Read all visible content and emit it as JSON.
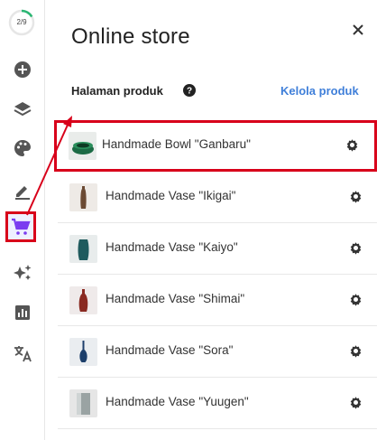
{
  "sidebar": {
    "progress": {
      "label": "2/9",
      "value": 0.222,
      "color": "#2bb673"
    },
    "items": [
      {
        "icon": "add-circle-icon"
      },
      {
        "icon": "layers-icon"
      },
      {
        "icon": "palette-icon"
      },
      {
        "icon": "edit-icon"
      },
      {
        "icon": "cart-icon",
        "active": true
      },
      {
        "icon": "sparkle-icon"
      },
      {
        "icon": "chart-icon"
      },
      {
        "icon": "translate-icon"
      }
    ]
  },
  "panel": {
    "title": "Online store",
    "section_label": "Halaman produk",
    "manage_link": "Kelola produk",
    "products": [
      {
        "name": "Handmade Bowl \"Ganbaru\"",
        "highlighted": true
      },
      {
        "name": "Handmade Vase \"Ikigai\""
      },
      {
        "name": "Handmade Vase \"Kaiyo\""
      },
      {
        "name": "Handmade Vase \"Shimai\""
      },
      {
        "name": "Handmade Vase \"Sora\""
      },
      {
        "name": "Handmade Vase \"Yuugen\""
      }
    ]
  },
  "colors": {
    "accent_link": "#3f7fd9",
    "highlight": "#d8001a",
    "active_icon": "#7a3cf0"
  }
}
